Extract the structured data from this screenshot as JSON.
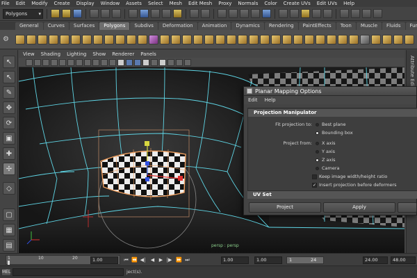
{
  "menubar": {
    "items": [
      "File",
      "Edit",
      "Modify",
      "Create",
      "Display",
      "Window",
      "Assets",
      "Select",
      "Mesh",
      "Edit Mesh",
      "Proxy",
      "Normals",
      "Color",
      "Create UVs",
      "Edit UVs",
      "Help"
    ]
  },
  "statusline": {
    "mode": "Polygons"
  },
  "shelf": {
    "tabs": [
      "General",
      "Curves",
      "Surfaces",
      "Polygons",
      "Subdivs",
      "Deformation",
      "Animation",
      "Dynamics",
      "Rendering",
      "PaintEffects",
      "Toon",
      "Muscle",
      "Fluids",
      "Fur"
    ],
    "active_tab": "Polygons"
  },
  "panel": {
    "menu": [
      "View",
      "Shading",
      "Lighting",
      "Show",
      "Renderer",
      "Panels"
    ],
    "camera_label": "persp : persp"
  },
  "attribute_strip": {
    "label": "Attribute Editor"
  },
  "dialog": {
    "title": "Planar Mapping Options",
    "menu": [
      "Edit",
      "Help"
    ],
    "projection_section": "Projection Manipulator",
    "fit_label": "Fit projection to:",
    "fit_options": [
      {
        "label": "Best plane",
        "selected": false
      },
      {
        "label": "Bounding box",
        "selected": true
      }
    ],
    "project_label": "Project from:",
    "project_options": [
      {
        "label": "X axis",
        "selected": false
      },
      {
        "label": "Y axis",
        "selected": false
      },
      {
        "label": "Z axis",
        "selected": true
      },
      {
        "label": "Camera",
        "selected": false
      }
    ],
    "keep_ratio": {
      "label": "Keep image width/height ratio",
      "checked": false
    },
    "insert_before": {
      "label": "Insert projection before deformers",
      "checked": true
    },
    "uvset_section": "UV Set",
    "buttons": {
      "project": "Project",
      "apply": "Apply"
    }
  },
  "timeline": {
    "ticks": [
      "1",
      "10",
      "20"
    ],
    "current_time": "1.00",
    "start_field": "1.00",
    "range_start": "1.00",
    "range_bar_start": "1",
    "range_bar_end": "24",
    "range_end": "24.00",
    "end_field": "48.00"
  },
  "cmdline": {
    "lang": "MEL",
    "help": "ject(s)."
  },
  "colors": {
    "wire": "#5fd6e6",
    "selection": "#f0a060",
    "background": "#1c1c1c"
  }
}
